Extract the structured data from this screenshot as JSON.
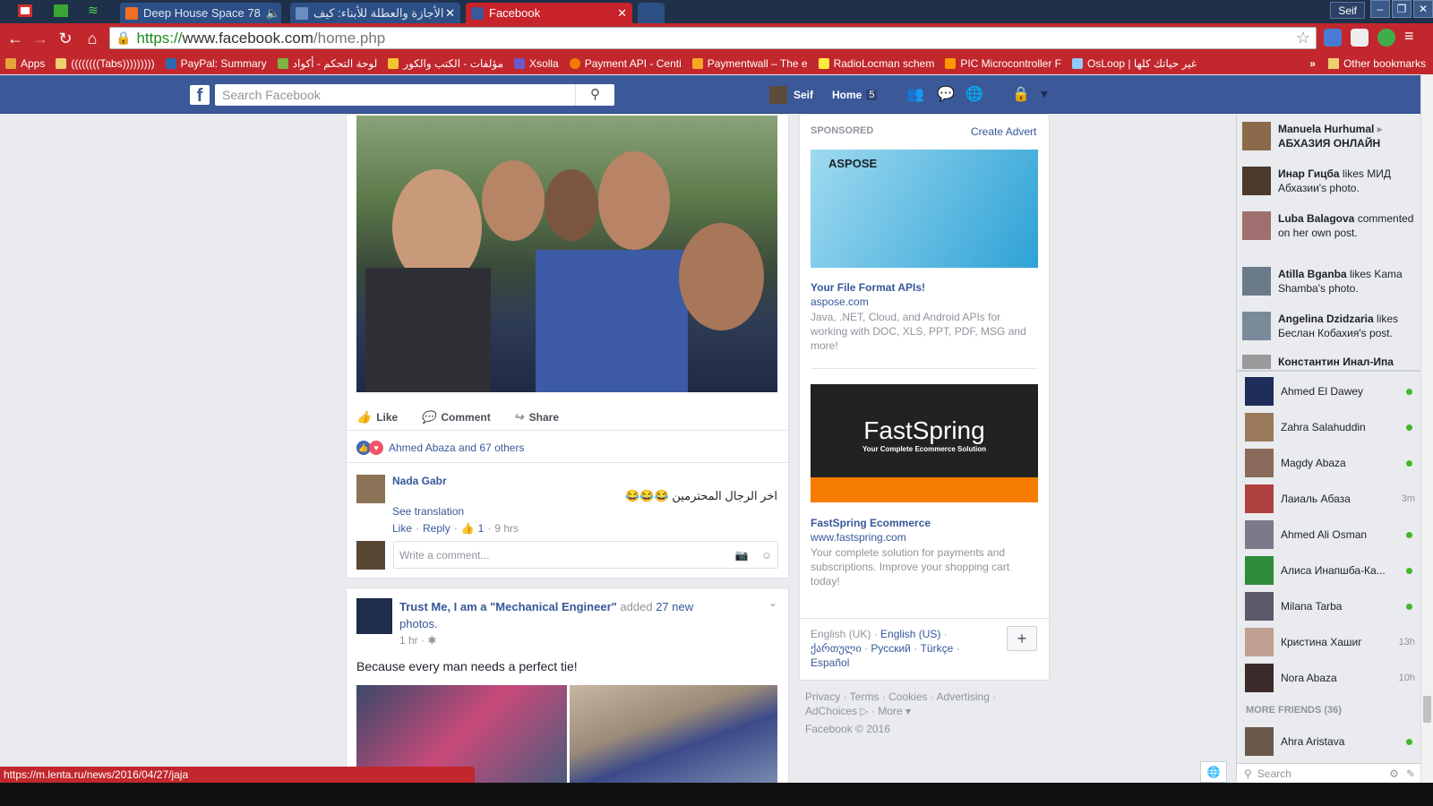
{
  "browser": {
    "tabs": [
      {
        "title": "Deep House Space 78",
        "active": false
      },
      {
        "title": "الأجازة والعطلة للأبناء: كيف",
        "active": false
      },
      {
        "title": "Facebook",
        "active": true
      }
    ],
    "profile_name": "Seif",
    "url": {
      "scheme": "https://",
      "host": "www.facebook.com",
      "path": "/home.php"
    },
    "bookmarks": [
      {
        "label": "Apps",
        "color": "#e8a33d"
      },
      {
        "label": "((((((((Tabs)))))))))",
        "color": "#f0d070"
      },
      {
        "label": "PayPal: Summary",
        "color": "#2b6cb0"
      },
      {
        "label": "لوحة التحكم - أكواد",
        "color": "#7cb342"
      },
      {
        "label": "مؤلفات - الكتب والكور",
        "color": "#f4c430"
      },
      {
        "label": "Xsolla",
        "color": "#6a5acd"
      },
      {
        "label": "Payment API - Centi",
        "color": "#f57c00"
      },
      {
        "label": "Paymentwall – The e",
        "color": "#f9a825"
      },
      {
        "label": "RadioLocman schem",
        "color": "#ffeb3b"
      },
      {
        "label": "PIC Microcontroller F",
        "color": "#ff9800"
      },
      {
        "label": "OsLoop | غير حياتك كلها",
        "color": "#90caf9"
      }
    ],
    "other_bookmarks": "Other bookmarks",
    "status_url": "https://m.lenta.ru/news/2016/04/27/jaja"
  },
  "fb": {
    "search_placeholder": "Search Facebook",
    "user": "Seif",
    "home_label": "Home",
    "home_count": "5"
  },
  "post1": {
    "actions": {
      "like": "Like",
      "comment": "Comment",
      "share": "Share"
    },
    "reactions_text": "Ahmed Abaza and 67 others",
    "comment": {
      "author": "Nada Gabr",
      "text": "اخر الرجال المحترمين 😂😂😂",
      "see_translation": "See translation",
      "like": "Like",
      "reply": "Reply",
      "likes": "1",
      "time": "9 hrs"
    },
    "write_placeholder": "Write a comment..."
  },
  "post2": {
    "page": "Trust Me, I am a \"Mechanical Engineer\"",
    "added": "added",
    "photos_count": "27 new",
    "photos_word": "photos.",
    "time": "1 hr",
    "text": "Because every man needs a perfect tie!"
  },
  "ads": {
    "sponsored": "SPONSORED",
    "create_advert": "Create Advert",
    "items": [
      {
        "brand": "ASPOSE",
        "title": "Your File Format APIs!",
        "domain": "aspose.com",
        "desc": "Java, .NET, Cloud, and Android APIs for working with DOC, XLS, PPT, PDF, MSG and more!"
      },
      {
        "brand": "FastSpring",
        "tagline": "Your Complete Ecommerce Solution",
        "title": "FastSpring Ecommerce",
        "domain": "www.fastspring.com",
        "desc": "Your complete solution for payments and subscriptions. Improve your shopping cart today!"
      }
    ]
  },
  "languages": {
    "current": "English (UK)",
    "others": [
      "English (US)",
      "ქართული",
      "Русский",
      "Türkçe",
      "Español"
    ],
    "add": "+"
  },
  "footer": {
    "links": [
      "Privacy",
      "Terms",
      "Cookies",
      "Advertising",
      "AdChoices",
      "More"
    ],
    "copyright": "Facebook © 2016"
  },
  "ticker": [
    {
      "name": "Manuela Hurhumal",
      "extra": "АБХАЗИЯ ОНЛАЙН",
      "text": ""
    },
    {
      "name": "Инар Гицба",
      "text": "likes МИД Абхазии's photo."
    },
    {
      "name": "Luba Balagova",
      "text": "commented on her own post."
    },
    {
      "name": "Atilla Bganba",
      "text": "likes Kama Shamba's photo."
    },
    {
      "name": "Angelina Dzidzaria",
      "text": "likes Беслан Кобахия's post."
    },
    {
      "name": "Константин Инал-Ипа",
      "text": ""
    }
  ],
  "friends": [
    {
      "name": "Ahmed El Dawey",
      "status": "online"
    },
    {
      "name": "Zahra Salahuddin",
      "status": "online"
    },
    {
      "name": "Magdy Abaza",
      "status": "online"
    },
    {
      "name": "Лаиаль Абаза",
      "status": "3m"
    },
    {
      "name": "Ahmed Ali Osman",
      "status": "online"
    },
    {
      "name": "Алиса Инапшба-Ка...",
      "status": "online"
    },
    {
      "name": "Milana Tarba",
      "status": "online"
    },
    {
      "name": "Кристина Хашиг",
      "status": "13h"
    },
    {
      "name": "Nora Abaza",
      "status": "10h"
    }
  ],
  "more_friends": "MORE FRIENDS (36)",
  "more_friends_list": [
    {
      "name": "Ahra Aristava",
      "status": "online"
    }
  ],
  "chat_search": "Search"
}
